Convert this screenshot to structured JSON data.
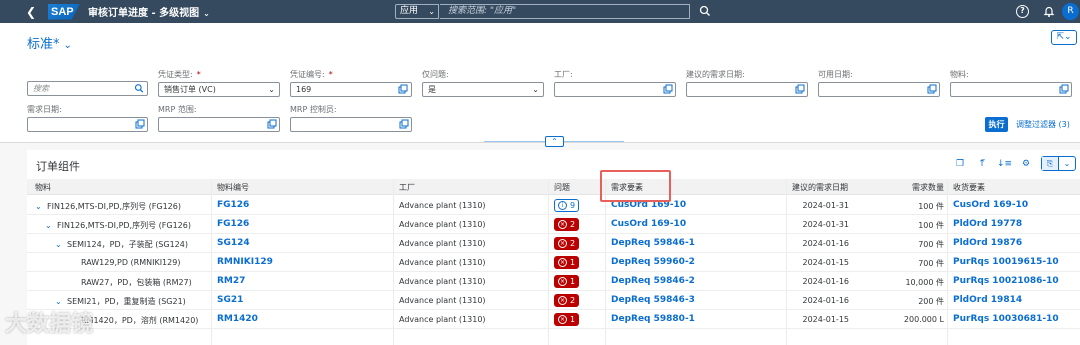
{
  "shell": {
    "back_glyph": "❮",
    "logo": "SAP",
    "title": "审核订单进度 - 多级视图",
    "title_chevron": "⌄",
    "scope": "应用",
    "search_placeholder": "搜索范围: \"应用\"",
    "help": "?",
    "avatar": "R"
  },
  "header": {
    "variant": "标准*",
    "variant_chevron": "⌄",
    "share": "⇱⌄"
  },
  "filters": [
    {
      "label": "",
      "value": "",
      "placeholder": "搜索",
      "required": false
    },
    {
      "label": "凭证类型:",
      "value": "销售订单 (VC)",
      "required": true
    },
    {
      "label": "凭证编号:",
      "value": "169",
      "required": true
    },
    {
      "label": "仅问题:",
      "value": "是",
      "required": false
    },
    {
      "label": "工厂:",
      "value": "",
      "required": false
    },
    {
      "label": "建议的需求日期:",
      "value": "",
      "required": false
    },
    {
      "label": "可用日期:",
      "value": "",
      "required": false
    },
    {
      "label": "物料:",
      "value": "",
      "required": false
    },
    {
      "label": "需求日期:",
      "value": "",
      "required": false
    },
    {
      "label": "MRP 范围:",
      "value": "",
      "required": false
    },
    {
      "label": "MRP 控制员:",
      "value": "",
      "required": false
    }
  ],
  "filter_actions": {
    "go": "执行",
    "adapt": "调整过滤器 (3)",
    "collapse": "⌃"
  },
  "table": {
    "title": "订单组件",
    "toolbar_icons": [
      "copy-icon",
      "sort-ascending-icon",
      "sort-descending-icon",
      "settings-icon",
      "export-icon"
    ],
    "columns": [
      "物料",
      "物料编号",
      "工厂",
      "问题",
      "需求要素",
      "建议的需求日期",
      "需求数量",
      "收货要素"
    ],
    "rows": [
      {
        "indent": 0,
        "expander": "⌄",
        "material": "FIN126,MTS-DI,PD,序列号 (FG126)",
        "number": "FG126",
        "plant": "Advance plant (1310)",
        "issue_type": "info",
        "issue_count": "9",
        "req": "CusOrd 169-10",
        "date": "2024-01-31",
        "qty": "100 件",
        "receipt": "CusOrd 169-10"
      },
      {
        "indent": 1,
        "expander": "⌄",
        "material": "FIN126,MTS-DI,PD,序列号 (FG126)",
        "number": "FG126",
        "plant": "Advance plant (1310)",
        "issue_type": "error",
        "issue_count": "2",
        "req": "CusOrd 169-10",
        "date": "2024-01-31",
        "qty": "100 件",
        "receipt": "PldOrd 19778"
      },
      {
        "indent": 2,
        "expander": "⌄",
        "material": "SEMI124，PD，子装配 (SG124)",
        "number": "SG124",
        "plant": "Advance plant (1310)",
        "issue_type": "error",
        "issue_count": "2",
        "req": "DepReq 59846-1",
        "date": "2024-01-16",
        "qty": "700 件",
        "receipt": "PldOrd 19876"
      },
      {
        "indent": 3,
        "expander": "",
        "material": "RAW129,PD (RMNIKI129)",
        "number": "RMNIKI129",
        "plant": "Advance plant (1310)",
        "issue_type": "error",
        "issue_count": "1",
        "req": "DepReq 59960-2",
        "date": "2024-01-15",
        "qty": "700 件",
        "receipt": "PurRqs 10019615-10"
      },
      {
        "indent": 3,
        "expander": "",
        "material": "RAW27，PD，包装箱 (RM27)",
        "number": "RM27",
        "plant": "Advance plant (1310)",
        "issue_type": "error",
        "issue_count": "1",
        "req": "DepReq 59846-2",
        "date": "2024-01-16",
        "qty": "10,000 件",
        "receipt": "PurRqs 10021086-10"
      },
      {
        "indent": 2,
        "expander": "⌄",
        "material": "SEMI21，PD，重复制造 (SG21)",
        "number": "SG21",
        "plant": "Advance plant (1310)",
        "issue_type": "error",
        "issue_count": "2",
        "req": "DepReq 59846-3",
        "date": "2024-01-16",
        "qty": "200 件",
        "receipt": "PldOrd 19814"
      },
      {
        "indent": 3,
        "expander": "",
        "material": "RM1420，PD，溶剂 (RM1420)",
        "number": "RM1420",
        "plant": "Advance plant (1310)",
        "issue_type": "error",
        "issue_count": "1",
        "req": "DepReq 59880-1",
        "date": "2024-01-15",
        "qty": "200.000 L",
        "receipt": "PurRqs 10030681-10"
      }
    ]
  },
  "watermark": "大数据镜",
  "colors": {
    "shell": "#354a5f",
    "accent": "#0a6ed1",
    "error": "#bb0000",
    "highlight": "#e8605a"
  }
}
